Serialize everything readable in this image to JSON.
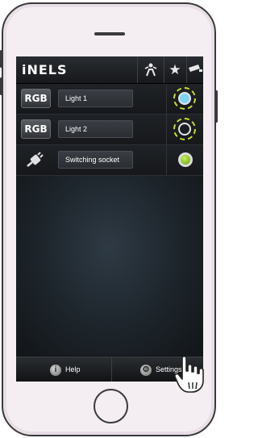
{
  "app": {
    "logo": "iNELS"
  },
  "topbar": {
    "icons": [
      "person-icon",
      "star-icon",
      "camera-icon"
    ]
  },
  "devices": [
    {
      "type_label": "RGB",
      "name": "Light 1",
      "state_color": "#7fd4f5"
    },
    {
      "type_label": "RGB",
      "name": "Light 2",
      "state_color": "#1a1f24"
    },
    {
      "icon": "plug-icon",
      "name": "Switching socket",
      "state_color": "#8ccf2a"
    }
  ],
  "bottombar": {
    "help_label": "Help",
    "settings_label": "Settings"
  },
  "colors": {
    "accent_ring": "#c8de2a",
    "bar_bg": "#1f2226"
  }
}
